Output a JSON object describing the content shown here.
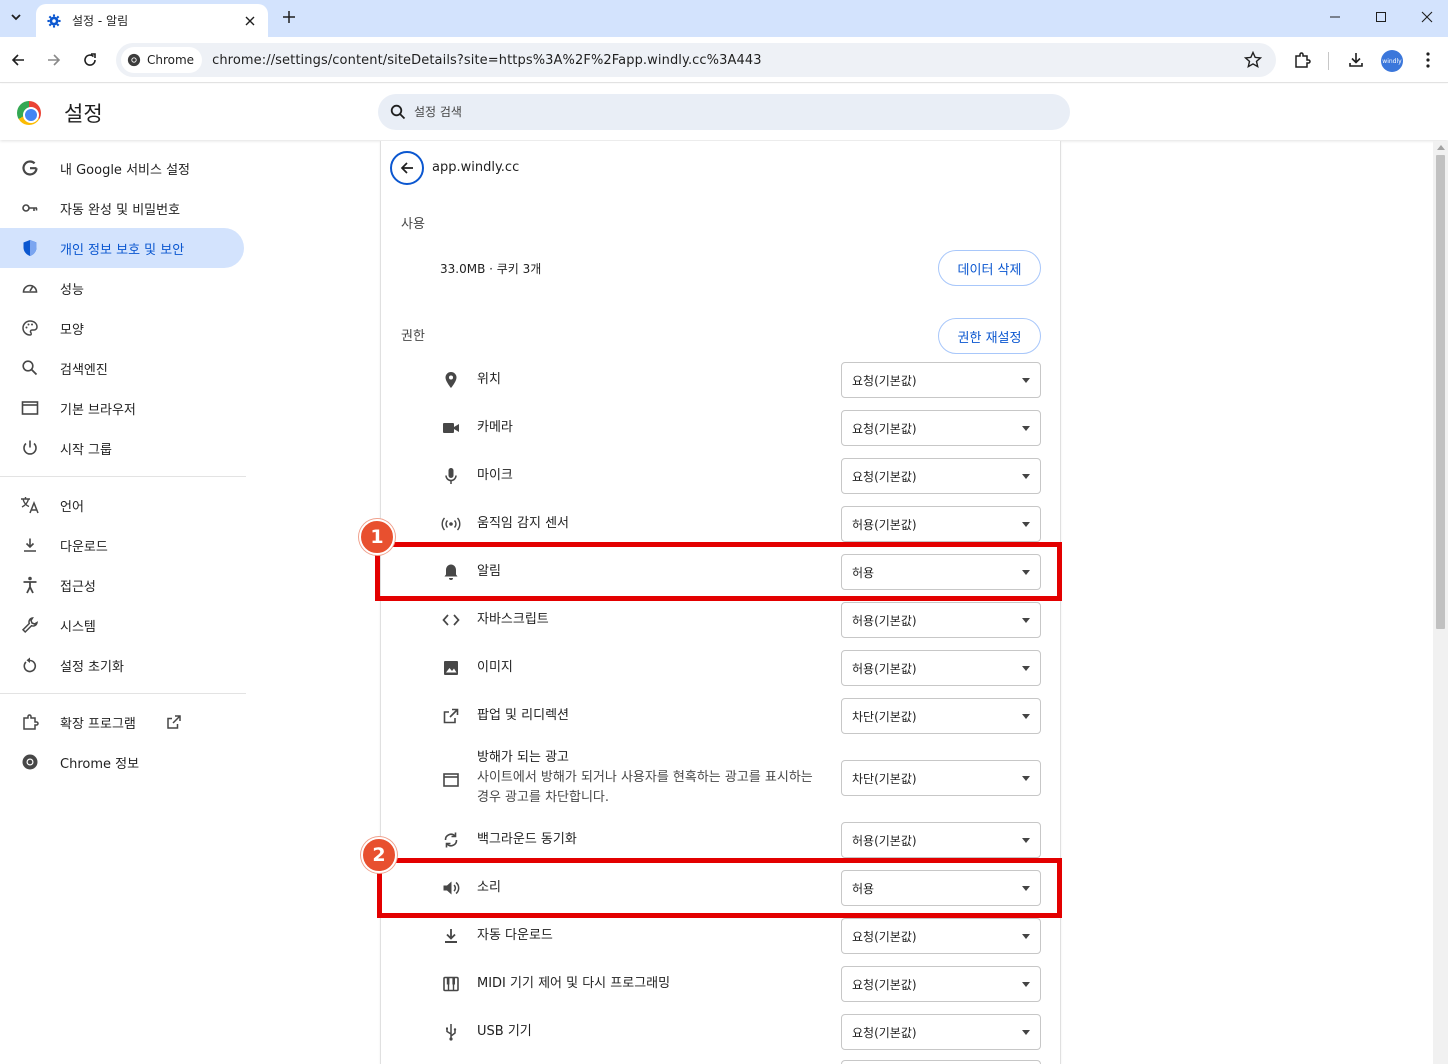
{
  "tab": {
    "title": "설정 - 알림"
  },
  "omnibox": {
    "chip": "Chrome",
    "url": "chrome://settings/content/siteDetails?site=https%3A%2F%2Fapp.windly.cc%3A443"
  },
  "profile": {
    "label": "windly"
  },
  "header": {
    "title": "설정",
    "search_placeholder": "설정 검색"
  },
  "sidebar": {
    "items": [
      {
        "label": "내 Google 서비스 설정",
        "icon": "google-g-icon"
      },
      {
        "label": "자동 완성 및 비밀번호",
        "icon": "key-icon"
      },
      {
        "label": "개인 정보 보호 및 보안",
        "icon": "shield-icon",
        "active": true
      },
      {
        "label": "성능",
        "icon": "speedometer-icon"
      },
      {
        "label": "모양",
        "icon": "palette-icon"
      },
      {
        "label": "검색엔진",
        "icon": "search-icon"
      },
      {
        "label": "기본 브라우저",
        "icon": "browser-window-icon"
      },
      {
        "label": "시작 그룹",
        "icon": "power-icon"
      },
      {
        "label": "언어",
        "icon": "translate-icon"
      },
      {
        "label": "다운로드",
        "icon": "download-icon"
      },
      {
        "label": "접근성",
        "icon": "accessibility-icon"
      },
      {
        "label": "시스템",
        "icon": "wrench-icon"
      },
      {
        "label": "설정 초기화",
        "icon": "reset-icon"
      },
      {
        "label": "확장 프로그램",
        "icon": "puzzle-icon"
      },
      {
        "label": "Chrome 정보",
        "icon": "chrome-icon"
      }
    ]
  },
  "site": {
    "name": "app.windly.cc",
    "usage_label": "사용",
    "usage_value": "33.0MB · 쿠키 3개",
    "clear_button": "데이터 삭제",
    "permissions_label": "권한",
    "reset_button": "권한 재설정"
  },
  "permissions": [
    {
      "label": "위치",
      "value": "요청(기본값)",
      "icon": "location-pin-icon"
    },
    {
      "label": "카메라",
      "value": "요청(기본값)",
      "icon": "camera-icon"
    },
    {
      "label": "마이크",
      "value": "요청(기본값)",
      "icon": "microphone-icon"
    },
    {
      "label": "움직임 감지 센서",
      "value": "허용(기본값)",
      "icon": "sensor-icon"
    },
    {
      "label": "알림",
      "value": "허용",
      "icon": "bell-icon"
    },
    {
      "label": "자바스크립트",
      "value": "허용(기본값)",
      "icon": "code-icon"
    },
    {
      "label": "이미지",
      "value": "허용(기본값)",
      "icon": "image-icon"
    },
    {
      "label": "팝업 및 리디렉션",
      "value": "차단(기본값)",
      "icon": "open-external-icon"
    },
    {
      "label": "방해가 되는 광고",
      "desc": "사이트에서 방해가 되거나 사용자를 현혹하는 광고를 표시하는 경우 광고를 차단합니다.",
      "value": "차단(기본값)",
      "icon": "ad-window-icon"
    },
    {
      "label": "백그라운드 동기화",
      "value": "허용(기본값)",
      "icon": "sync-icon"
    },
    {
      "label": "소리",
      "value": "허용",
      "icon": "speaker-icon"
    },
    {
      "label": "자동 다운로드",
      "value": "요청(기본값)",
      "icon": "download-icon"
    },
    {
      "label": "MIDI 기기 제어 및 다시 프로그래밍",
      "value": "요청(기본값)",
      "icon": "piano-icon"
    },
    {
      "label": "USB 기기",
      "value": "요청(기본값)",
      "icon": "usb-icon"
    }
  ],
  "annotations": [
    {
      "number": "1"
    },
    {
      "number": "2"
    }
  ],
  "colors": {
    "accent": "#0b57d0",
    "active_nav_bg": "#d3e3fd",
    "highlight": "#e30000",
    "badge": "#e8502f"
  }
}
